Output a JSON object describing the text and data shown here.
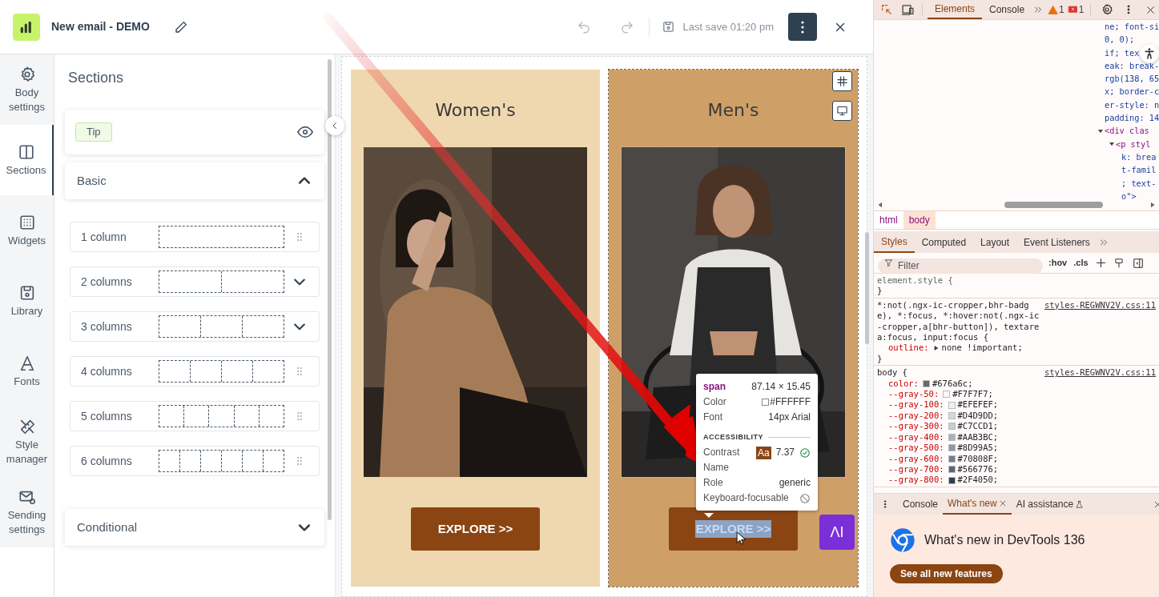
{
  "header": {
    "title": "New email - DEMO",
    "last_save": "Last save 01:20 pm"
  },
  "nav": [
    {
      "label": "Body settings",
      "kind": "gear",
      "selected": false
    },
    {
      "label": "Sections",
      "kind": "columns",
      "selected": true
    },
    {
      "label": "Widgets",
      "kind": "grid",
      "selected": false
    },
    {
      "label": "Library",
      "kind": "disk",
      "selected": false
    },
    {
      "label": "Fonts",
      "kind": "font",
      "selected": false
    },
    {
      "label": "Style manager",
      "kind": "tools",
      "selected": false
    },
    {
      "label": "Sending settings",
      "kind": "mail",
      "selected": false
    }
  ],
  "panel": {
    "title": "Sections",
    "tip": "Tip",
    "groups": [
      {
        "label": "Basic",
        "expanded": true,
        "items": [
          {
            "label": "1 column",
            "kind": "draggable"
          },
          {
            "label": "2 columns",
            "kind": "expandable"
          },
          {
            "label": "3 columns",
            "kind": "expandable"
          },
          {
            "label": "4 columns",
            "kind": "draggable"
          },
          {
            "label": "5 columns",
            "kind": "draggable"
          },
          {
            "label": "6 columns",
            "kind": "draggable"
          }
        ]
      },
      {
        "label": "Conditional",
        "expanded": false
      }
    ]
  },
  "email": {
    "columns": [
      {
        "heading": "Women's",
        "button": "EXPLORE >>",
        "color": "#efd8b0",
        "selected": false,
        "text_selected": false
      },
      {
        "heading": "Men's",
        "button": "EXPLORE >>",
        "color": "#cf9f68",
        "selected": true,
        "text_selected": true
      }
    ],
    "ai_button": "ΛI"
  },
  "inspect_tooltip": {
    "tag": "span",
    "size": "87.14 × 15.45",
    "rows": [
      {
        "label": "Color",
        "value": "#FFFFFF",
        "kind": "color"
      },
      {
        "label": "Font",
        "value": "14px Arial",
        "kind": "text"
      }
    ],
    "section": "ACCESSIBILITY",
    "a11y_rows": [
      {
        "label": "Contrast",
        "badge": "Aa",
        "value": "7.37",
        "kind": "contrast"
      },
      {
        "label": "Name",
        "kind": "text"
      },
      {
        "label": "Role",
        "value": "generic",
        "kind": "text"
      },
      {
        "label": "Keyboard-focusable",
        "kind": "blocked"
      }
    ]
  },
  "devtools": {
    "tabs": [
      {
        "label": "Elements",
        "selected": true
      },
      {
        "label": "Console",
        "selected": false
      }
    ],
    "warnings": "1",
    "errors": "1",
    "code": [
      {
        "text": "ne; font-si",
        "kind": "attr"
      },
      {
        "text": "0, 0);",
        "kind": "attr"
      },
      {
        "text": "if; tex",
        "kind": "attr"
      },
      {
        "text": "eak: break-",
        "kind": "attr"
      },
      {
        "text": "rgb(138, 65",
        "kind": "attr"
      },
      {
        "text": "x; border-c",
        "kind": "attr"
      },
      {
        "text": "er-style: n",
        "kind": "attr"
      },
      {
        "text": "padding: 14",
        "kind": "attr"
      },
      {
        "text": "<div clas",
        "kind": "node"
      },
      {
        "text": "<p styl",
        "kind": "child-node"
      },
      {
        "text": "k: brea",
        "kind": "child-attr"
      },
      {
        "text": "t-famil",
        "kind": "child-attr"
      },
      {
        "text": "; text-",
        "kind": "child-attr"
      },
      {
        "text": "o\">",
        "kind": "child-attr"
      }
    ],
    "breadcrumb": [
      {
        "label": "html",
        "selected": false
      },
      {
        "label": "body",
        "selected": true
      }
    ],
    "subtabs": [
      {
        "label": "Styles",
        "selected": true
      },
      {
        "label": "Computed",
        "selected": false
      },
      {
        "label": "Layout",
        "selected": false
      },
      {
        "label": "Event Listeners",
        "selected": false
      }
    ],
    "filter": {
      "placeholder": "Filter",
      "hov": ":hov",
      "cls": ".cls"
    },
    "rules": [
      {
        "selector": "element.style {",
        "end": "}"
      },
      {
        "selector": "*:not(.ngx-ic-cropper,bhr-badge), *:focus, *:hover:not(.ngx-ic-cropper,a[bhr-button]), textarea:focus, input:focus {",
        "source": "styles-REGWNV2V.css:11",
        "declarations": [
          {
            "property": "outline:",
            "value": "none !important;",
            "expandable": true
          }
        ],
        "end": "}"
      },
      {
        "selector": "body {",
        "source": "styles-REGWNV2V.css:11",
        "declarations": [
          {
            "property": "color:",
            "value": "#676a6c;",
            "color": "#676a6c"
          },
          {
            "property": "--gray-50:",
            "value": "#F7F7F7;",
            "color": "#f7f7f7"
          },
          {
            "property": "--gray-100:",
            "value": "#EFEFEF;",
            "color": "#efefef"
          },
          {
            "property": "--gray-200:",
            "value": "#D4D9DD;",
            "color": "#d4d9dd"
          },
          {
            "property": "--gray-300:",
            "value": "#C7CCD1;",
            "color": "#c7ccd1"
          },
          {
            "property": "--gray-400:",
            "value": "#AAB3BC;",
            "color": "#aab3bc"
          },
          {
            "property": "--gray-500:",
            "value": "#8D99A5;",
            "color": "#8d99a5"
          },
          {
            "property": "--gray-600:",
            "value": "#70808F;",
            "color": "#70808f"
          },
          {
            "property": "--gray-700:",
            "value": "#566776;",
            "color": "#566776"
          },
          {
            "property": "--gray-800:",
            "value": "#2F4050;",
            "color": "#2f4050"
          }
        ]
      }
    ],
    "drawer_tabs": [
      {
        "label": "Console",
        "selected": false
      },
      {
        "label": "What's new",
        "selected": true,
        "closable": true
      },
      {
        "label": "AI assistance",
        "selected": false,
        "beta": true
      }
    ],
    "whats_new": {
      "title": "What's new in DevTools 136",
      "button": "See all new features"
    }
  }
}
